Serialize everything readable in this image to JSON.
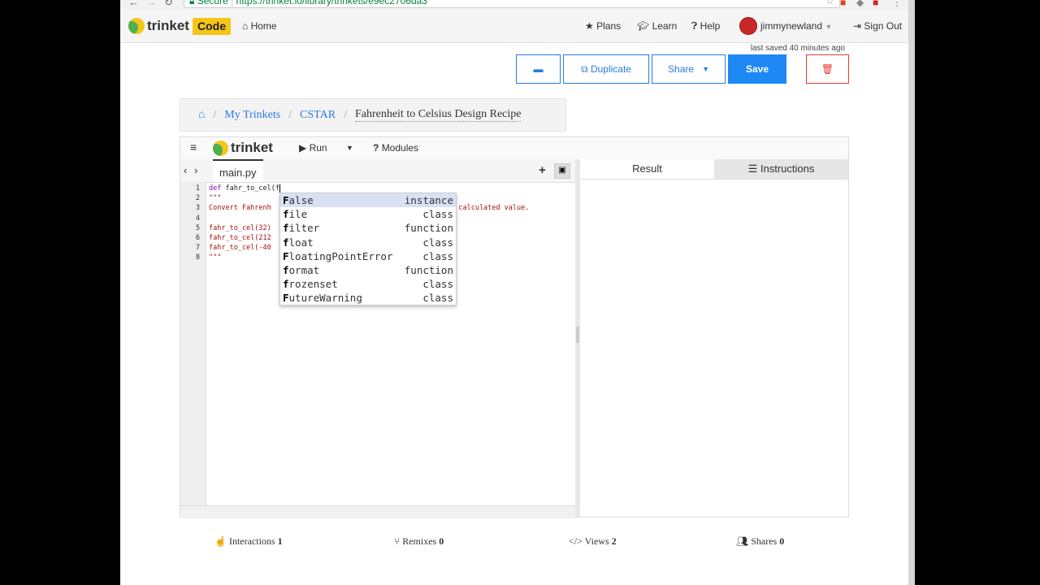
{
  "browser": {
    "secure_label": "Secure",
    "url": "https://trinket.io/library/trinkets/e9ec2706da3"
  },
  "navbar": {
    "logo_text": "trinket",
    "code_badge": "Code",
    "home": "Home",
    "plans": "Plans",
    "learn": "Learn",
    "help": "Help",
    "username": "jimmynewland",
    "signout": "Sign Out",
    "icons": {
      "home": "home-icon",
      "plans": "star-icon",
      "learn": "graduation-cap-icon",
      "help": "question-circle-icon",
      "signout": "sign-out-icon"
    }
  },
  "status": {
    "last_saved": "last saved 40 minutes ago"
  },
  "actions": {
    "duplicate": "Duplicate",
    "share": "Share",
    "save": "Save"
  },
  "breadcrumb": {
    "my_trinkets": "My Trinkets",
    "group": "CSTAR",
    "current": "Fahrenheit to Celsius Design Recipe"
  },
  "embed": {
    "logo_text": "trinket",
    "run": "Run",
    "modules": "Modules",
    "file_tab": "main.py",
    "result_tab": "Result",
    "instructions_tab": "Instructions"
  },
  "code": {
    "line_numbers": [
      "1",
      "2",
      "3",
      "4",
      "5",
      "6",
      "7",
      "8"
    ],
    "line1_kw": "def",
    "line1_rest": " fahr_to_cel(f",
    "line2": "\"\"\"",
    "line3_left": "Convert Fahrenh",
    "line3_right": "ew calculated value.",
    "line5": "fahr_to_cel(32)",
    "line6": "fahr_to_cel(212",
    "line7": "fahr_to_cel(-40",
    "line8": "\"\"\""
  },
  "autocomplete": [
    {
      "first": "F",
      "rest": "alse",
      "type": "instance"
    },
    {
      "first": "f",
      "rest": "ile",
      "type": "class"
    },
    {
      "first": "f",
      "rest": "ilter",
      "type": "function"
    },
    {
      "first": "f",
      "rest": "loat",
      "type": "class"
    },
    {
      "first": "F",
      "rest": "loatingPointError",
      "type": "class"
    },
    {
      "first": "f",
      "rest": "ormat",
      "type": "function"
    },
    {
      "first": "f",
      "rest": "rozenset",
      "type": "class"
    },
    {
      "first": "F",
      "rest": "utureWarning",
      "type": "class"
    }
  ],
  "stats": {
    "interactions_label": "Interactions",
    "interactions": "1",
    "remixes_label": "Remixes",
    "remixes": "0",
    "views_label": "Views",
    "views": "2",
    "shares_label": "Shares",
    "shares": "0"
  },
  "colors": {
    "accent": "#2a7be4",
    "save": "#1e88f5",
    "danger": "#e53935",
    "brand_yellow": "#f5c518"
  }
}
